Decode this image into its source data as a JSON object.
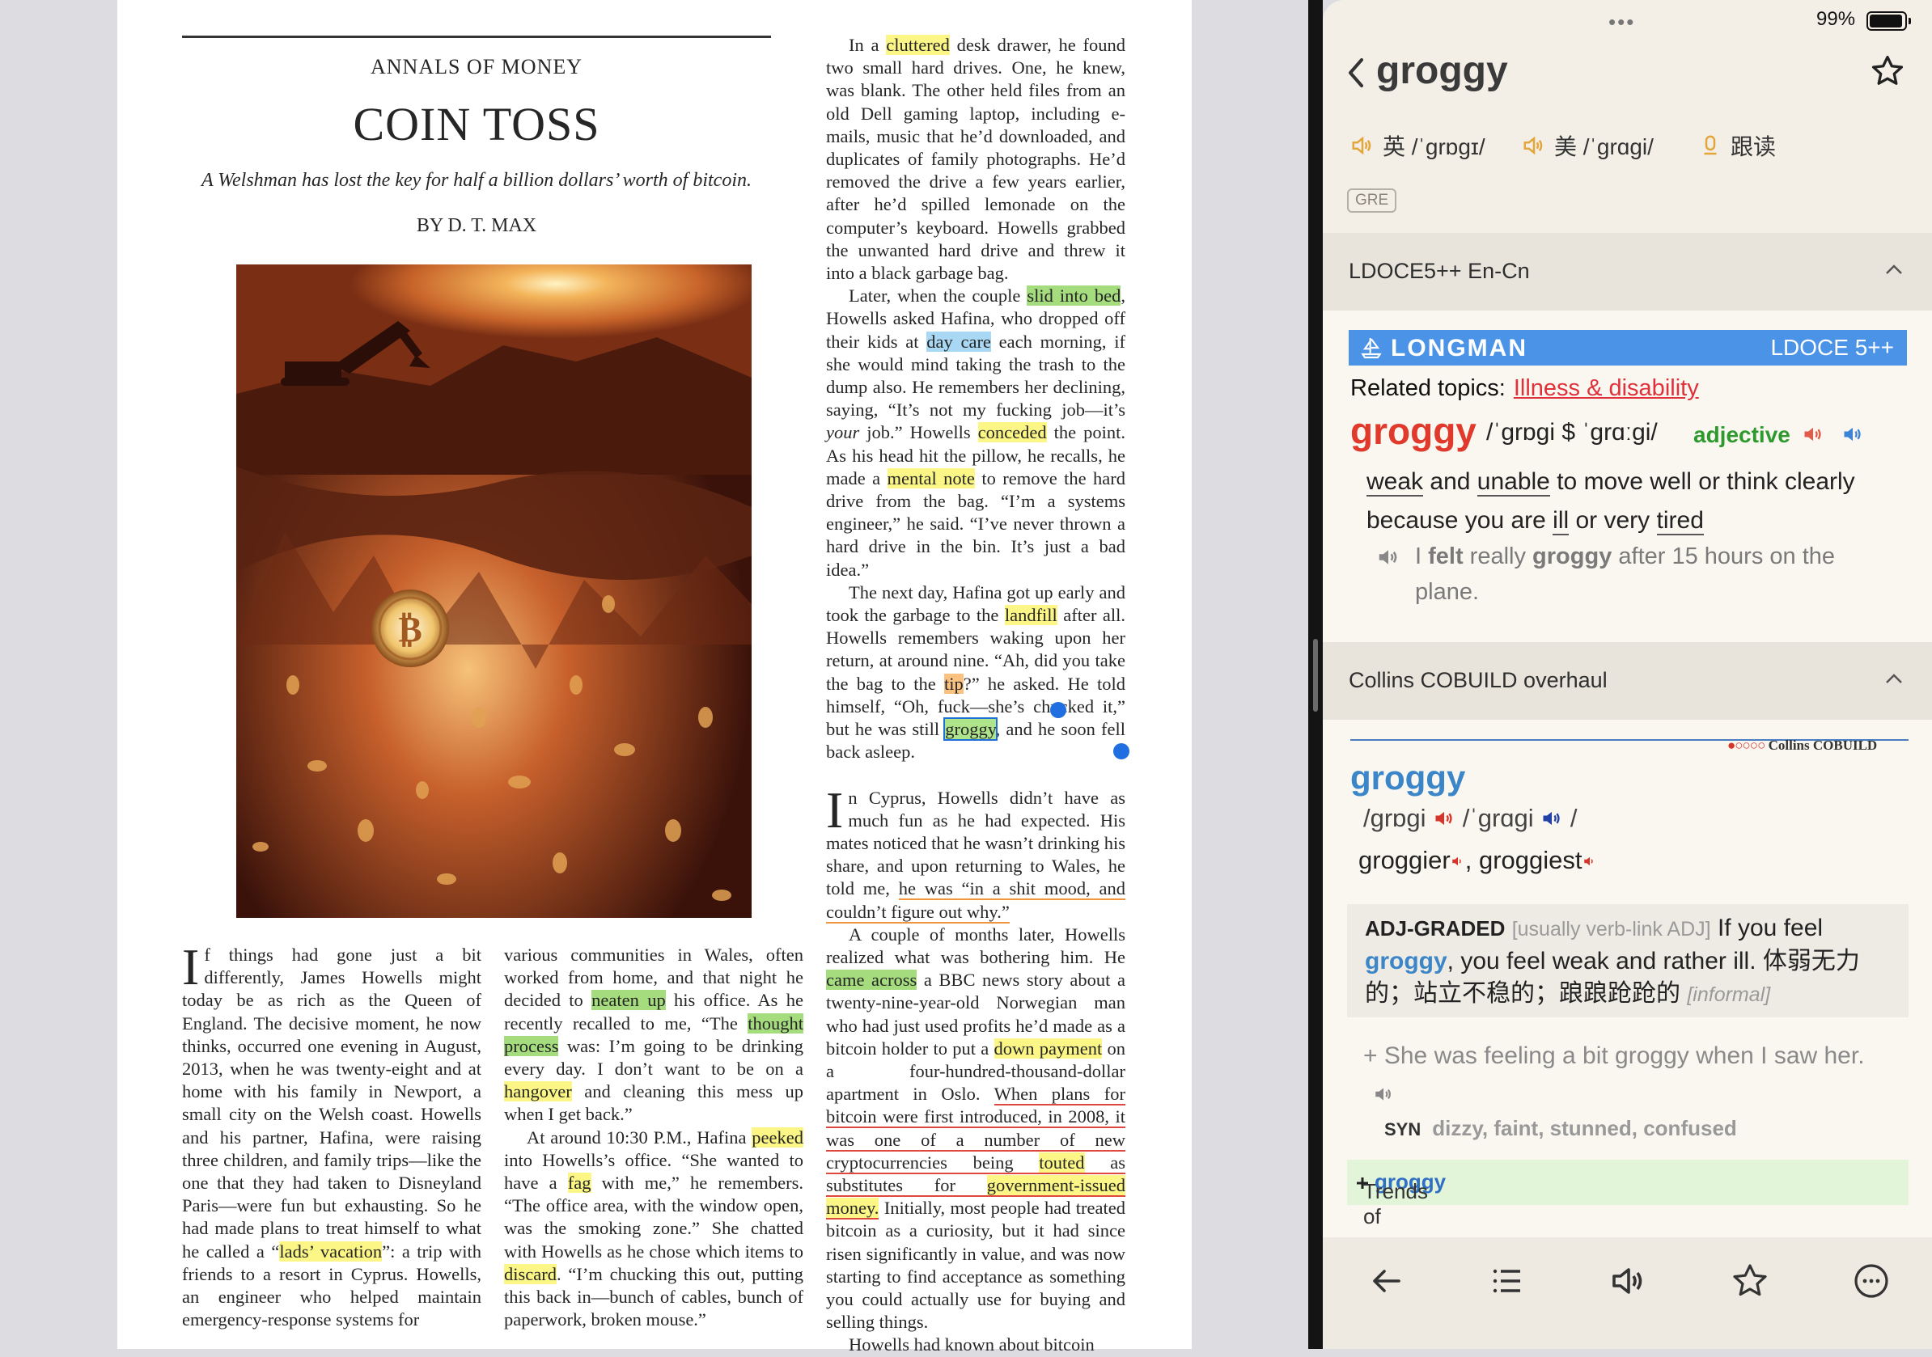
{
  "article": {
    "kicker": "ANNALS OF MONEY",
    "headline": "COIN TOSS",
    "dek": "A Welshman has lost the key for half a billion dollars’ worth of bitcoin.",
    "byline": "BY D. T. MAX",
    "photo_alt": "bitcoin-landfill-photo",
    "col1": {
      "dropcap": "I",
      "p1a": "f things had gone just a bit differently, James Howells might today be as rich as the Queen of England. The decisive moment, he now thinks, occurred one evening in August, 2013, when he was twenty-eight and at home with his family in Newport, a small city on the Welsh coast. Howells and his partner, Hafina, were raising three children, and family trips—like the one that they had taken to Disneyland Paris—were fun but exhausting. So he had made plans to treat himself to what he called a “",
      "p1_hl": "lads’ vacation",
      "p1b": "”: a trip with friends to a resort in Cyprus. Howells, an engineer who helped maintain emergency-response systems for"
    },
    "col2": {
      "p1a": "various communities in Wales, often worked from home, and that night he decided to ",
      "hl_neaten": "neaten up",
      "p1b": " his office. As he recently recalled to me, “The ",
      "hl_thought": "thought process",
      "p1c": " was: I’m going to be drinking every day. I don’t want to be on a ",
      "hl_hangover": "hangover",
      "p1d": " and cleaning this mess up when I get back.”",
      "p2a": "At around 10:30 P.M., Hafina ",
      "hl_peeked": "peeked",
      "p2b": " into Howells’s office. “She wanted to have a ",
      "hl_fag": "fag",
      "p2c": " with me,” he remembers. “The office area, with the window open, was the smoking zone.” She chatted with Howells as he chose which items to ",
      "hl_discard": "discard",
      "p2d": ". “I’m chucking this out, putting this back in—bunch of cables, bunch of paperwork, broken mouse.”"
    },
    "col3": {
      "p1a": "In a ",
      "hl_cluttered": "cluttered",
      "p1b": " desk drawer, he found two small hard drives. One, he knew, was blank. The other held files from an old Dell gaming laptop, including e-mails, music that he’d downloaded, and duplicates of family photographs. He’d removed the drive a few years earlier, after he’d spilled lemonade on the computer’s keyboard. Howells grabbed the unwanted hard drive and threw it into a black garbage bag.",
      "p2a": "Later, when the couple ",
      "hl_slid": "slid into bed",
      "p2b": ", Howells asked Hafina, who dropped off their kids at ",
      "hl_daycare": "day care",
      "p2c": " each morning, if she would mind taking the trash to the dump also. He remembers her declining, saying, “It’s not my fucking job—it’s ",
      "p2_your": "your",
      "p2d": " job.” Howells ",
      "hl_conceded": "conceded",
      "p2e": " the point. As his head hit the pillow, he recalls, he made a ",
      "hl_mental": "mental note",
      "p2f": " to remove the hard drive from the bag. “I’m a systems engineer,” he said. “I’ve never thrown a hard drive in the bin. It’s just a bad idea.”",
      "p3a": "The next day, Hafina got up early and took the garbage to the ",
      "hl_landfill": "landfill",
      "p3b": " after all. Howells remembers waking upon her return, at around nine. “Ah, did you take the bag to the ",
      "hl_tip": "tip",
      "p3c": "?” he asked. He told himself, “Oh, fuck—she’s chucked it,” but he was still ",
      "sel_groggy": "groggy",
      "p3d": ", and he soon fell back asleep.",
      "dropcap2": "I",
      "p4a": "n Cyprus, Howells didn’t have as much fun as he had expected. His mates noticed that he wasn’t drinking his share, and upon returning to Wales, he told me, ",
      "u_shit": "he was “in a shit mood, and couldn’t figure out why.”",
      "p5a": "A couple of months later, Howells realized what was bothering him. He ",
      "hl_came": "came across",
      "p5b": " a BBC news story about a twenty-nine-year-old Norwegian man who had just used profits he’d made as a bitcoin holder to put a ",
      "hl_down": "down payment",
      "p5c": " on a four-hundred-thousand-dollar apartment in Oslo. ",
      "u_plans1": "When plans for bitcoin were first introduced, in 2008, it was one of a number of new cryptocurrencies being ",
      "hl_touted": "touted",
      "u_plans2": " as substitutes for ",
      "hl_gov": "government-issued money.",
      "p5d": " Initially, most people had treated bitcoin as a curiosity, but it had since risen significantly in value, and was now starting to find acceptance as something you could actually use for buying and selling things.",
      "p6": "Howells had known about bitcoin"
    }
  },
  "status": {
    "dots": "•••",
    "battery": "99%"
  },
  "dict": {
    "word": "groggy",
    "uk_label": "英 /ˈɡrɒɡɪ/",
    "us_label": "美 /ˈɡrɑɡi/",
    "follow_label": "跟读",
    "tag": "GRE",
    "ldoce": {
      "section_title": "LDOCE5++ En-Cn",
      "brand": "LONGMAN",
      "version": "LDOCE 5++",
      "related_label": "Related topics:",
      "related_link": "Illness & disability",
      "headword": "groggy",
      "pron": "/ˈɡrɒɡi $ ˈɡrɑːɡi/",
      "pos": "adjective",
      "def_w1": "weak",
      "def_t1": " and ",
      "def_w2": "unable",
      "def_t2": " to move well or think clearly because you are ",
      "def_w3": "ill",
      "def_t3": " or very ",
      "def_w4": "tired",
      "ex_a": "I ",
      "ex_b": "felt",
      "ex_c": " really ",
      "ex_d": "groggy",
      "ex_e": " after 15 hours on the plane."
    },
    "collins": {
      "section_title": "Collins COBUILD overhaul",
      "logo": "Collins COBUILD",
      "headword": "groggy",
      "pron_a": "/ɡrɒɡi",
      "pron_b": "/ˈɡrɑɡi",
      "pron_c": "/",
      "form1": "groggier",
      "form_sep": ", ",
      "form2": "groggiest",
      "label": "ADJ-GRADED",
      "gram": "[usually verb-link ADJ]",
      "def_a": " If you feel ",
      "def_hw": "groggy",
      "def_b": ", you feel weak and rather ill. 体弱无力的；站立不稳的；踉踉跄跄的 ",
      "informal": "[informal]",
      "example": "+ She was feeling a bit groggy when I saw her.",
      "syn_label": "SYN",
      "synonyms": "dizzy, faint, stunned, confused",
      "trends_pre": "Trends of ",
      "trends_word": "groggy"
    }
  }
}
